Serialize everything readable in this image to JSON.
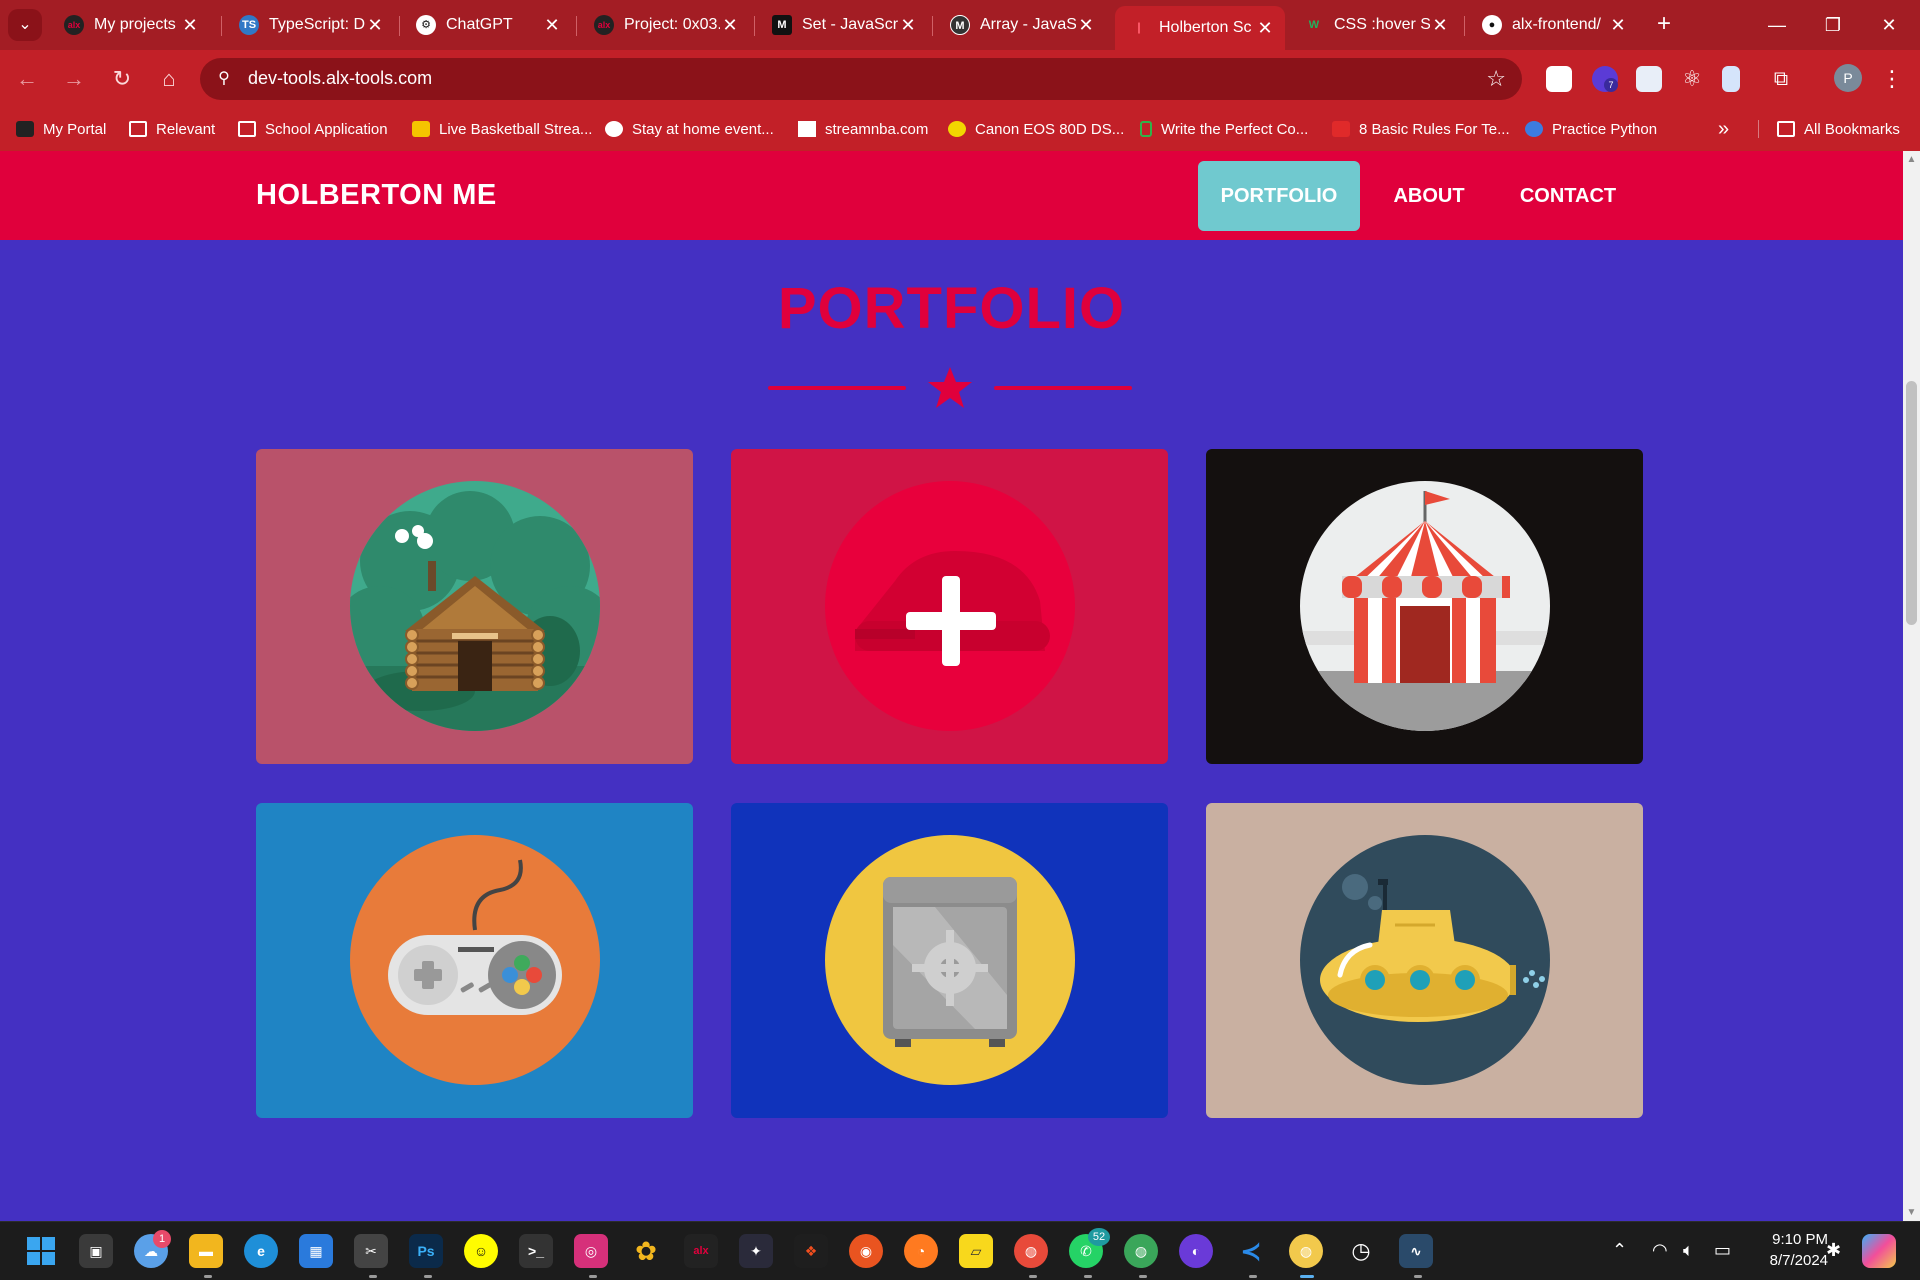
{
  "browser": {
    "tabs": [
      {
        "title": "My projects |",
        "active": false
      },
      {
        "title": "TypeScript: D",
        "active": false
      },
      {
        "title": "ChatGPT",
        "active": false
      },
      {
        "title": "Project: 0x03.",
        "active": false
      },
      {
        "title": "Set - JavaScri",
        "active": false
      },
      {
        "title": "Array - JavaSc",
        "active": false
      },
      {
        "title": "Holberton Sc",
        "active": true
      },
      {
        "title": "CSS :hover Se",
        "active": false
      },
      {
        "title": "alx-frontend/",
        "active": false
      }
    ],
    "url": "dev-tools.alx-tools.com",
    "ext_badge": "7",
    "profile_initial": "P",
    "bookmarks": [
      {
        "label": "My Portal"
      },
      {
        "label": "Relevant"
      },
      {
        "label": "School Application"
      },
      {
        "label": "Live Basketball Strea..."
      },
      {
        "label": "Stay at home event..."
      },
      {
        "label": "streamnba.com"
      },
      {
        "label": "Canon EOS 80D DS..."
      },
      {
        "label": "Write the Perfect Co..."
      },
      {
        "label": "8 Basic Rules For Te..."
      },
      {
        "label": "Practice Python"
      }
    ],
    "all_bookmarks": "All Bookmarks",
    "overflow": "»"
  },
  "site": {
    "brand": "HOLBERTON ME",
    "nav": [
      {
        "label": "PORTFOLIO",
        "active": true
      },
      {
        "label": "ABOUT",
        "active": false
      },
      {
        "label": "CONTACT",
        "active": false
      }
    ],
    "section_title": "PORTFOLIO",
    "colors": {
      "header": "#e0003c",
      "page_bg": "#4430c2",
      "active_nav": "#70c9cf"
    },
    "portfolio": [
      {
        "name": "cabin",
        "bg": "#b9526a"
      },
      {
        "name": "cake",
        "bg": "#d01446"
      },
      {
        "name": "circus",
        "bg": "#14100f"
      },
      {
        "name": "game-controller",
        "bg": "#1f84c4"
      },
      {
        "name": "safe",
        "bg": "#1033bb"
      },
      {
        "name": "submarine",
        "bg": "#c9b0a1"
      }
    ]
  },
  "taskbar": {
    "badges": {
      "weather": "1",
      "whatsapp": "52"
    },
    "icons": [
      "windows-start",
      "task-view",
      "weather",
      "file-explorer",
      "edge",
      "store",
      "snipping-tool",
      "photoshop",
      "snapchat",
      "terminal",
      "instagram",
      "photos",
      "alx",
      "davinci",
      "figma",
      "ubuntu",
      "firefox",
      "sticky-notes",
      "chrome-a",
      "whatsapp",
      "chrome-b",
      "github",
      "vscode",
      "chrome-c",
      "speedtest",
      "monitor"
    ],
    "ps_label": "Ps",
    "time": "9:10 PM",
    "date": "8/7/2024"
  }
}
